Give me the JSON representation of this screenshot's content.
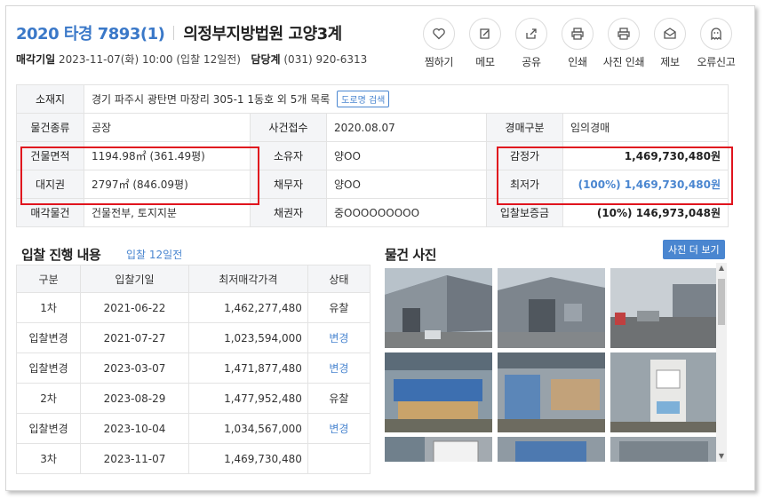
{
  "header": {
    "case_number": "2020 타경 7893(1)",
    "court": "의정부지방법원 고양3계",
    "sale_date_label": "매각기일",
    "sale_date_value": "2023-11-07(화) 10:00 (입찰 12일전)",
    "dept_label": "담당계",
    "dept_phone": "(031) 920-6313"
  },
  "actions": [
    {
      "label": "찜하기",
      "icon": "heart-icon"
    },
    {
      "label": "메모",
      "icon": "memo-icon"
    },
    {
      "label": "공유",
      "icon": "share-icon"
    },
    {
      "label": "인쇄",
      "icon": "print-icon"
    },
    {
      "label": "사진 인쇄",
      "icon": "photo-print-icon"
    },
    {
      "label": "제보",
      "icon": "report-icon"
    },
    {
      "label": "오류신고",
      "icon": "error-report-icon"
    }
  ],
  "info": {
    "address_label": "소재지",
    "address_value": "경기 파주시 광탄면 마장리 305-1 1동호 외 5개 목록",
    "road_btn": "도로명 검색",
    "type_label": "물건종류",
    "type_value": "공장",
    "received_label": "사건접수",
    "received_value": "2020.08.07",
    "auction_type_label": "경매구분",
    "auction_type_value": "임의경매",
    "building_area_label": "건물면적",
    "building_area_value": "1194.98㎡ (361.49평)",
    "owner_label": "소유자",
    "owner_value": "양OO",
    "appraisal_label": "감정가",
    "appraisal_value": "1,469,730,480원",
    "land_right_label": "대지권",
    "land_right_value": "2797㎡ (846.09평)",
    "debtor_label": "채무자",
    "debtor_value": "양OO",
    "min_price_label": "최저가",
    "min_price_value": "(100%) 1,469,730,480원",
    "sale_items_label": "매각물건",
    "sale_items_value": "건물전부, 토지지분",
    "creditor_label": "채권자",
    "creditor_value": "중OOOOOOOOO",
    "deposit_label": "입찰보증금",
    "deposit_value": "(10%) 146,973,048원"
  },
  "bids": {
    "title": "입찰 진행 내용",
    "subtitle": "입찰 12일전",
    "columns": [
      "구분",
      "입찰기일",
      "최저매각가격",
      "상태"
    ],
    "rows": [
      [
        "1차",
        "2021-06-22",
        "1,462,277,480",
        "유찰"
      ],
      [
        "입찰변경",
        "2021-07-27",
        "1,023,594,000",
        "변경"
      ],
      [
        "입찰변경",
        "2023-03-07",
        "1,471,877,480",
        "변경"
      ],
      [
        "2차",
        "2023-08-29",
        "1,477,952,480",
        "유찰"
      ],
      [
        "입찰변경",
        "2023-10-04",
        "1,034,567,000",
        "변경"
      ],
      [
        "3차",
        "2023-11-07",
        "1,469,730,480",
        ""
      ]
    ]
  },
  "photos": {
    "title": "물건 사진",
    "more_btn": "사진 더 보기"
  },
  "colors": {
    "accent": "#4a86d0",
    "highlight_box": "#e0141e"
  }
}
